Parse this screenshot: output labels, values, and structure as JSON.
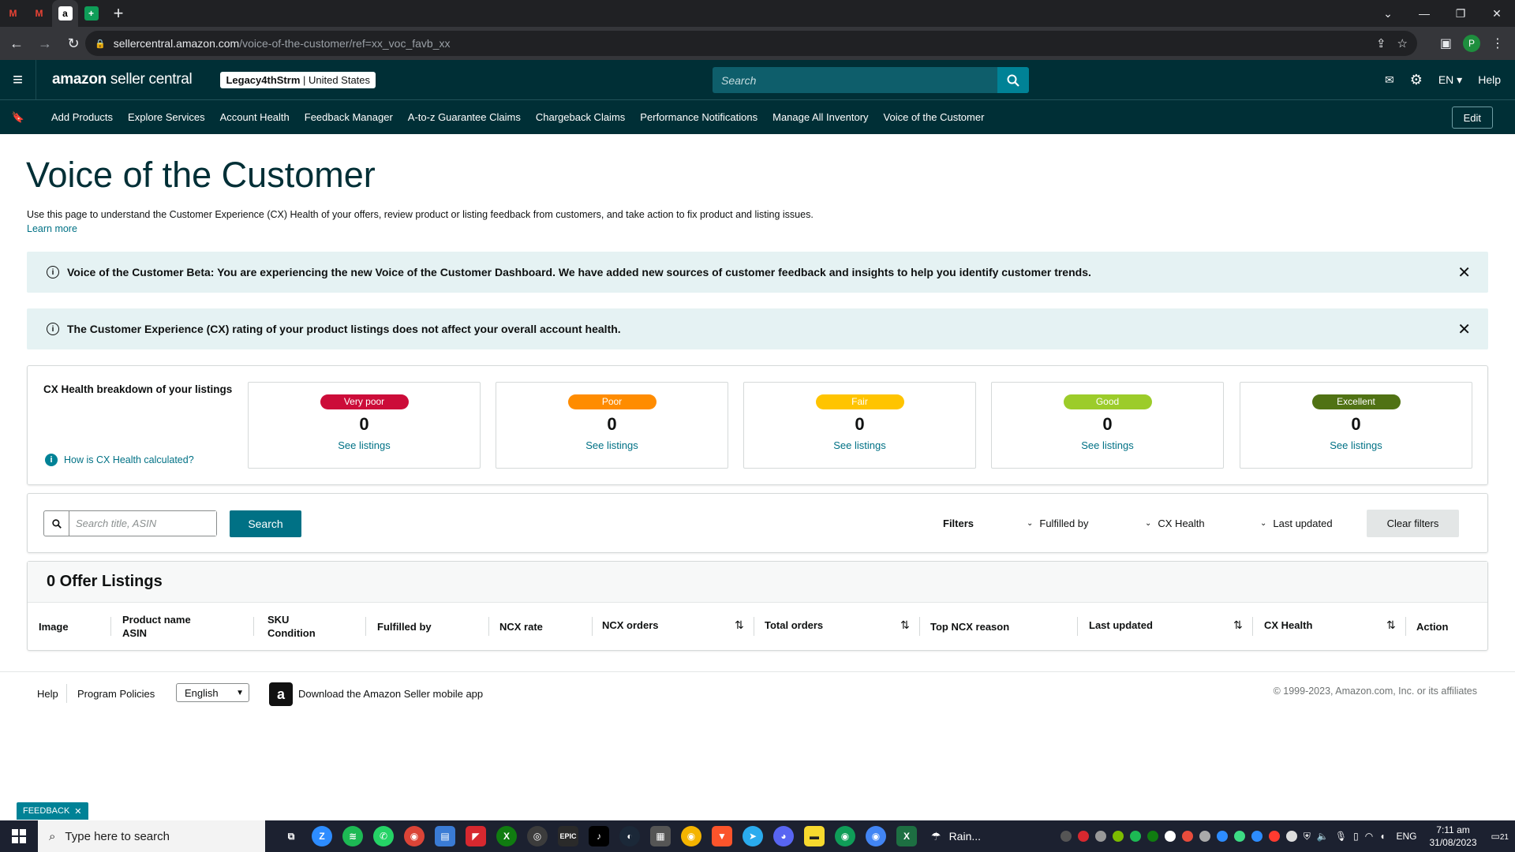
{
  "browser": {
    "tabs": [
      {
        "icon": "gmail-icon",
        "letter": "M",
        "color": "#ea4335"
      },
      {
        "icon": "gmail-icon",
        "letter": "M",
        "color": "#ea4335"
      },
      {
        "icon": "amazon-icon",
        "letter": "a",
        "color": "#ffffff"
      },
      {
        "icon": "sheets-icon",
        "letter": "+",
        "color": "#0f9d58"
      }
    ],
    "url_host": "sellercentral.amazon.com",
    "url_path": "/voice-of-the-customer/ref=xx_voc_favb_xx",
    "profile_initial": "P"
  },
  "header": {
    "logo_bold": "amazon",
    "logo_rest": " seller central",
    "account_name": "Legacy4thStrm",
    "account_region": " | United States",
    "search_placeholder": "Search",
    "language": "EN",
    "help": "Help"
  },
  "bookmarks": {
    "items": [
      "Add Products",
      "Explore Services",
      "Account Health",
      "Feedback Manager",
      "A-to-z Guarantee Claims",
      "Chargeback Claims",
      "Performance Notifications",
      "Manage All Inventory",
      "Voice of the Customer"
    ],
    "edit": "Edit"
  },
  "page": {
    "title": "Voice of the Customer",
    "description": "Use this page to understand the Customer Experience (CX) Health of your offers, review product or listing feedback from customers, and take action to fix product and listing issues.",
    "learn_more": "Learn more"
  },
  "banners": [
    {
      "text": "Voice of the Customer Beta: You are experiencing the new Voice of the Customer Dashboard. We have added new sources of customer feedback and insights to help you identify customer trends."
    },
    {
      "text": "The Customer Experience (CX) rating of your product listings does not affect your overall account health."
    }
  ],
  "cx_health": {
    "title": "CX Health breakdown of your listings",
    "help_link": "How is CX Health calculated?",
    "cards": [
      {
        "label": "Very poor",
        "count": "0",
        "link": "See listings",
        "color": "#cc0c39"
      },
      {
        "label": "Poor",
        "count": "0",
        "link": "See listings",
        "color": "#ff8c00"
      },
      {
        "label": "Fair",
        "count": "0",
        "link": "See listings",
        "color": "#ffc400"
      },
      {
        "label": "Good",
        "count": "0",
        "link": "See listings",
        "color": "#9ccc2a"
      },
      {
        "label": "Excellent",
        "count": "0",
        "link": "See listings",
        "color": "#507214"
      }
    ]
  },
  "search": {
    "placeholder": "Search title, ASIN",
    "button": "Search",
    "filters_label": "Filters",
    "filters": [
      "Fulfilled by",
      "CX Health",
      "Last updated"
    ],
    "clear": "Clear filters"
  },
  "listings": {
    "header": "0 Offer Listings",
    "columns": [
      {
        "line1": "Image",
        "line2": ""
      },
      {
        "line1": "Product name",
        "line2": "ASIN"
      },
      {
        "line1": "SKU",
        "line2": "Condition"
      },
      {
        "line1": "Fulfilled by",
        "line2": ""
      },
      {
        "line1": "NCX rate",
        "line2": ""
      },
      {
        "line1": "NCX orders",
        "line2": ""
      },
      {
        "line1": "Total orders",
        "line2": ""
      },
      {
        "line1": "Top NCX reason",
        "line2": ""
      },
      {
        "line1": "Last updated",
        "line2": ""
      },
      {
        "line1": "CX Health",
        "line2": ""
      },
      {
        "line1": "Action",
        "line2": ""
      }
    ]
  },
  "footer": {
    "help": "Help",
    "policies": "Program Policies",
    "language": "English",
    "app_text": "Download the Amazon Seller mobile app",
    "copyright": "© 1999-2023, Amazon.com, Inc. or its affiliates"
  },
  "feedback_tab": "FEEDBACK",
  "taskbar": {
    "search_placeholder": "Type here to search",
    "weather": "Rain...",
    "lang": "ENG",
    "time": "7:11 am",
    "date": "31/08/2023",
    "notifications": "21"
  }
}
